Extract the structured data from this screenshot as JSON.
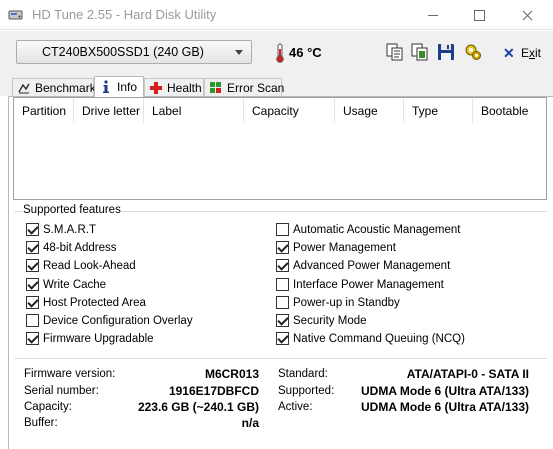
{
  "window": {
    "title": "HD Tune 2.55 - Hard Disk Utility"
  },
  "toolbar": {
    "drive": "CT240BX500SSD1 (240 GB)",
    "temperature": "46 °C",
    "icons": [
      "copy-text-icon",
      "copy-screen-icon",
      "save-icon",
      "options-icon"
    ],
    "exit_label": "Exit",
    "exit_underline_letter": "x"
  },
  "tabs": [
    {
      "label": "Benchmark",
      "icon": "benchmark-icon",
      "active": false
    },
    {
      "label": "Info",
      "icon": "info-icon",
      "active": true
    },
    {
      "label": "Health",
      "icon": "health-icon",
      "active": false
    },
    {
      "label": "Error Scan",
      "icon": "error-scan-icon",
      "active": false
    }
  ],
  "partition_table": {
    "columns": [
      "Partition",
      "Drive letter",
      "Label",
      "Capacity",
      "Usage",
      "Type",
      "Bootable"
    ]
  },
  "features": {
    "title": "Supported features",
    "left": [
      {
        "label": "S.M.A.R.T",
        "checked": true
      },
      {
        "label": "48-bit Address",
        "checked": true
      },
      {
        "label": "Read Look-Ahead",
        "checked": true
      },
      {
        "label": "Write Cache",
        "checked": true
      },
      {
        "label": "Host Protected Area",
        "checked": true
      },
      {
        "label": "Device Configuration Overlay",
        "checked": false
      },
      {
        "label": "Firmware Upgradable",
        "checked": true
      }
    ],
    "right": [
      {
        "label": "Automatic Acoustic Management",
        "checked": false
      },
      {
        "label": "Power Management",
        "checked": true
      },
      {
        "label": "Advanced Power Management",
        "checked": true
      },
      {
        "label": "Interface Power Management",
        "checked": false
      },
      {
        "label": "Power-up in Standby",
        "checked": false
      },
      {
        "label": "Security Mode",
        "checked": true
      },
      {
        "label": "Native Command Queuing (NCQ)",
        "checked": true
      }
    ]
  },
  "info": {
    "firmware_label": "Firmware version:",
    "firmware": "M6CR013",
    "serial_label": "Serial number:",
    "serial": "1916E17DBFCD",
    "capacity_label": "Capacity:",
    "capacity": "223.6 GB (~240.1 GB)",
    "buffer_label": "Buffer:",
    "buffer": "n/a",
    "standard_label": "Standard:",
    "standard": "ATA/ATAPI-0 - SATA II",
    "supported_label": "Supported:",
    "supported": "UDMA Mode 6 (Ultra ATA/133)",
    "active_label": "Active:",
    "active": "UDMA Mode 6 (Ultra ATA/133)"
  }
}
